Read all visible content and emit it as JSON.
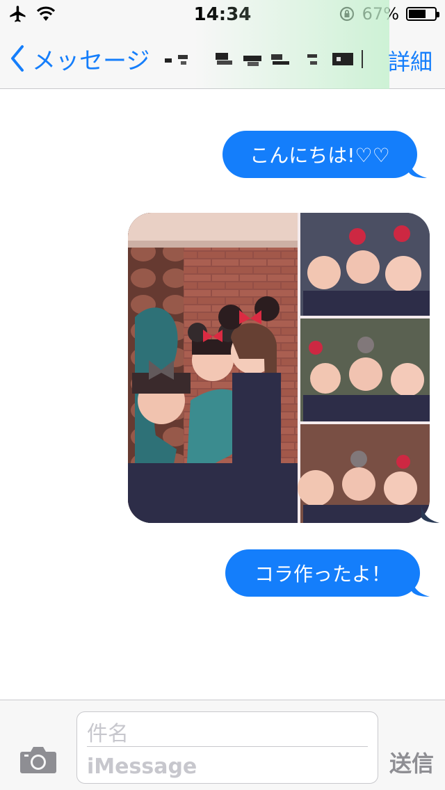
{
  "status_bar": {
    "time": "14:34",
    "battery_percent": "67%",
    "battery_level": 0.67,
    "icons": [
      "airplane-icon",
      "wifi-icon",
      "rotation-lock-icon",
      "battery-icon"
    ]
  },
  "nav": {
    "back_label": "メッセージ",
    "details_label": "詳細",
    "recipient_obscured": true
  },
  "messages": [
    {
      "type": "text",
      "direction": "outgoing",
      "text": "こんにちは!♡♡"
    },
    {
      "type": "image",
      "direction": "outgoing",
      "description_icon": "photo-collage"
    },
    {
      "type": "text",
      "direction": "outgoing",
      "text": "コラ作ったよ！"
    }
  ],
  "composer": {
    "subject_placeholder": "件名",
    "message_placeholder": "iMessage",
    "send_label": "送信"
  },
  "colors": {
    "accent": "#157efb",
    "bubble": "#147efb",
    "placeholder": "#c7c7cd",
    "send_disabled": "#8e8e93"
  }
}
